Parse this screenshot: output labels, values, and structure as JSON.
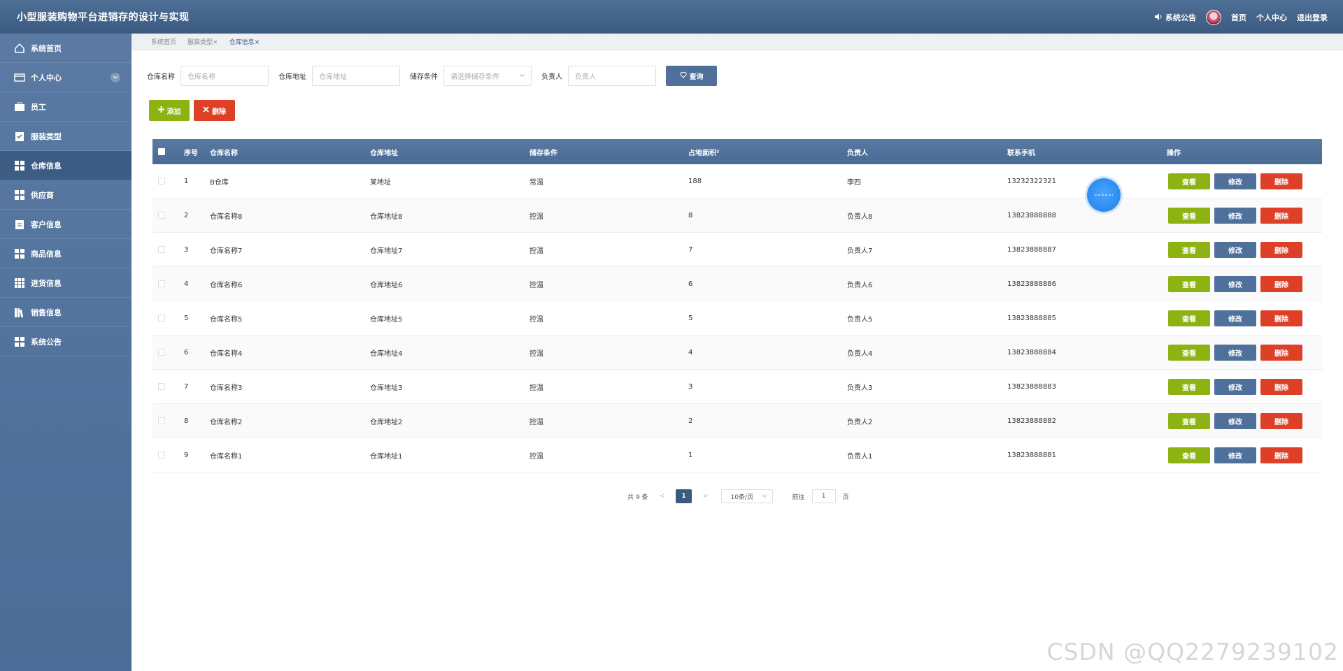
{
  "header": {
    "title": "小型服装购物平台进销存的设计与实现",
    "notice_label": "系统公告",
    "home_label": "首页",
    "profile_label": "个人中心",
    "logout_label": "退出登录"
  },
  "sidebar": {
    "items": [
      {
        "label": "系统首页",
        "icon": "home-icon"
      },
      {
        "label": "个人中心",
        "icon": "card-icon"
      },
      {
        "label": "员工",
        "icon": "briefcase-icon"
      },
      {
        "label": "服装类型",
        "icon": "clipboard-check-icon"
      },
      {
        "label": "仓库信息",
        "icon": "grid-icon"
      },
      {
        "label": "供应商",
        "icon": "grid-icon"
      },
      {
        "label": "客户信息",
        "icon": "clipboard-icon"
      },
      {
        "label": "商品信息",
        "icon": "grid-icon"
      },
      {
        "label": "进货信息",
        "icon": "apps-icon"
      },
      {
        "label": "销售信息",
        "icon": "books-icon"
      },
      {
        "label": "系统公告",
        "icon": "grid-icon"
      }
    ],
    "active": "仓库信息"
  },
  "breadcrumb": {
    "tabs": [
      "系统首页",
      "服装类型",
      "仓库信息"
    ],
    "close_glyph": "×"
  },
  "search": {
    "name_label": "仓库名称",
    "name_placeholder": "仓库名称",
    "address_label": "仓库地址",
    "address_placeholder": "仓库地址",
    "condition_label": "储存条件",
    "condition_placeholder": "请选择储存条件",
    "manager_label": "负责人",
    "manager_placeholder": "负责人",
    "query_label": "查询"
  },
  "actions": {
    "add_label": "添加",
    "delete_label": "删除"
  },
  "table": {
    "columns": [
      "序号",
      "仓库名称",
      "仓库地址",
      "储存条件",
      "占地面积²",
      "负责人",
      "联系手机",
      "操作"
    ],
    "rows": [
      [
        "1",
        "B仓库",
        "某地址",
        "常温",
        "188",
        "李四",
        "13232322321"
      ],
      [
        "2",
        "仓库名称8",
        "仓库地址8",
        "控温",
        "8",
        "负责人8",
        "13823888888"
      ],
      [
        "3",
        "仓库名称7",
        "仓库地址7",
        "控温",
        "7",
        "负责人7",
        "13823888887"
      ],
      [
        "4",
        "仓库名称6",
        "仓库地址6",
        "控温",
        "6",
        "负责人6",
        "13823888886"
      ],
      [
        "5",
        "仓库名称5",
        "仓库地址5",
        "控温",
        "5",
        "负责人5",
        "13823888885"
      ],
      [
        "6",
        "仓库名称4",
        "仓库地址4",
        "控温",
        "4",
        "负责人4",
        "13823888884"
      ],
      [
        "7",
        "仓库名称3",
        "仓库地址3",
        "控温",
        "3",
        "负责人3",
        "13823888883"
      ],
      [
        "8",
        "仓库名称2",
        "仓库地址2",
        "控温",
        "2",
        "负责人2",
        "13823888882"
      ],
      [
        "9",
        "仓库名称1",
        "仓库地址1",
        "控温",
        "1",
        "负责人1",
        "13823888881"
      ]
    ],
    "view_label": "查看",
    "edit_label": "修改",
    "remove_label": "删除"
  },
  "pagination": {
    "total_text": "共 9 条",
    "prev_glyph": "<",
    "current_page": "1",
    "next_glyph": ">",
    "page_size": "10条/页",
    "goto_label": "前往",
    "goto_value": "1",
    "page_unit": "页"
  },
  "watermark": "CSDN @QQ2279239102",
  "colors": {
    "header": "#3b5a80",
    "sidebar": "#5a7aa3",
    "success": "#8db312",
    "danger": "#dd3f27",
    "primary": "#4f709a"
  }
}
